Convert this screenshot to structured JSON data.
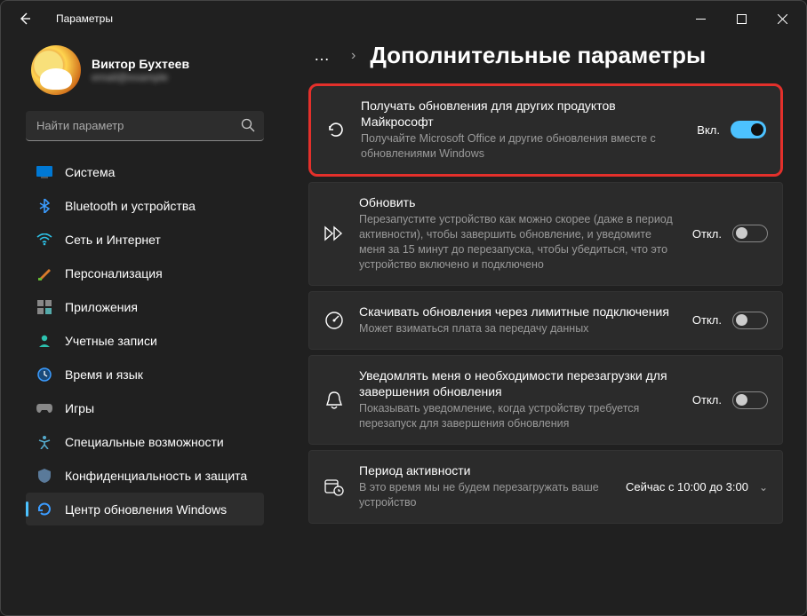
{
  "window": {
    "title": "Параметры"
  },
  "profile": {
    "name": "Виктор Бухтеев",
    "sub": "email@example"
  },
  "search": {
    "placeholder": "Найти параметр"
  },
  "nav": {
    "items": [
      {
        "label": "Система"
      },
      {
        "label": "Bluetooth и устройства"
      },
      {
        "label": "Сеть и Интернет"
      },
      {
        "label": "Персонализация"
      },
      {
        "label": "Приложения"
      },
      {
        "label": "Учетные записи"
      },
      {
        "label": "Время и язык"
      },
      {
        "label": "Игры"
      },
      {
        "label": "Специальные возможности"
      },
      {
        "label": "Конфиденциальность и защита"
      },
      {
        "label": "Центр обновления Windows"
      }
    ]
  },
  "page": {
    "title": "Дополнительные параметры"
  },
  "labels": {
    "on": "Вкл.",
    "off": "Откл."
  },
  "cards": [
    {
      "title": "Получать обновления для других продуктов Майкрософт",
      "desc": "Получайте Microsoft Office и другие обновления вместе с обновлениями Windows",
      "state": "on"
    },
    {
      "title": "Обновить",
      "desc": "Перезапустите устройство как можно скорее (даже в период активности), чтобы завершить обновление, и уведомите меня за 15 минут до перезапуска, чтобы убедиться, что это устройство включено и подключено",
      "state": "off"
    },
    {
      "title": "Скачивать обновления через лимитные подключения",
      "desc": "Может взиматься плата за передачу данных",
      "state": "off"
    },
    {
      "title": "Уведомлять меня о необходимости перезагрузки для завершения обновления",
      "desc": "Показывать уведомление, когда устройству требуется перезапуск для завершения обновления",
      "state": "off"
    },
    {
      "title": "Период активности",
      "desc": "В это время мы не будем перезагружать ваше устройство",
      "value": "Сейчас с 10:00 до 3:00"
    }
  ]
}
